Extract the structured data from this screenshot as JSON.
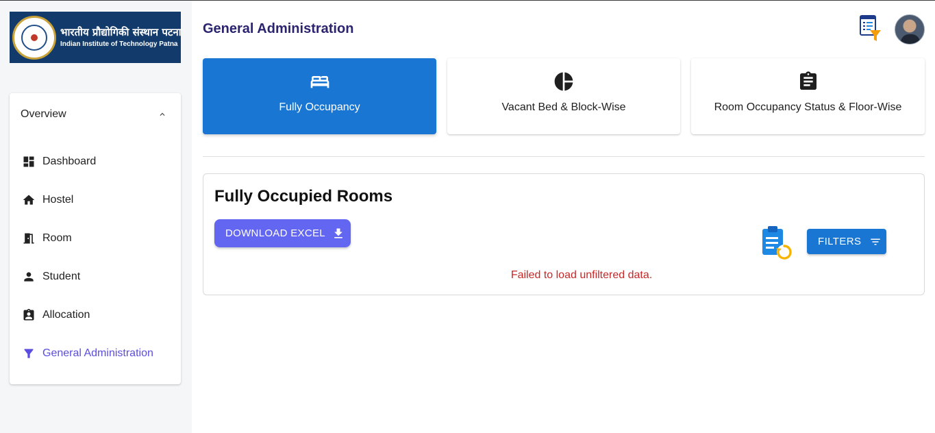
{
  "branding": {
    "institute_hindi": "भारतीय प्रौद्योगिकी संस्थान पटना",
    "institute_english": "Indian Institute of Technology Patna",
    "brand_color": "#123b6b"
  },
  "sidebar": {
    "section_label": "Overview",
    "items": [
      {
        "label": "Dashboard",
        "icon": "dashboard-icon"
      },
      {
        "label": "Hostel",
        "icon": "home-icon"
      },
      {
        "label": "Room",
        "icon": "door-icon"
      },
      {
        "label": "Student",
        "icon": "person-icon"
      },
      {
        "label": "Allocation",
        "icon": "assignment-ind-icon"
      },
      {
        "label": "General Administration",
        "icon": "filter-icon",
        "active": true
      }
    ],
    "active_color": "#5b4de0"
  },
  "header": {
    "title": "General Administration"
  },
  "tabs": [
    {
      "label": "Fully Occupancy",
      "icon": "bed-icon",
      "active": true
    },
    {
      "label": "Vacant Bed & Block-Wise",
      "icon": "pie-chart-icon"
    },
    {
      "label": "Room Occupancy Status & Floor-Wise",
      "icon": "clipboard-icon"
    }
  ],
  "panel": {
    "title": "Fully Occupied Rooms",
    "download_label": "DOWNLOAD EXCEL",
    "filters_label": "FILTERS",
    "error_message": "Failed to load unfiltered data."
  },
  "colors": {
    "primary": "#1976d2",
    "accent": "#6366f1",
    "title": "#2a2470",
    "error": "#c62828"
  }
}
